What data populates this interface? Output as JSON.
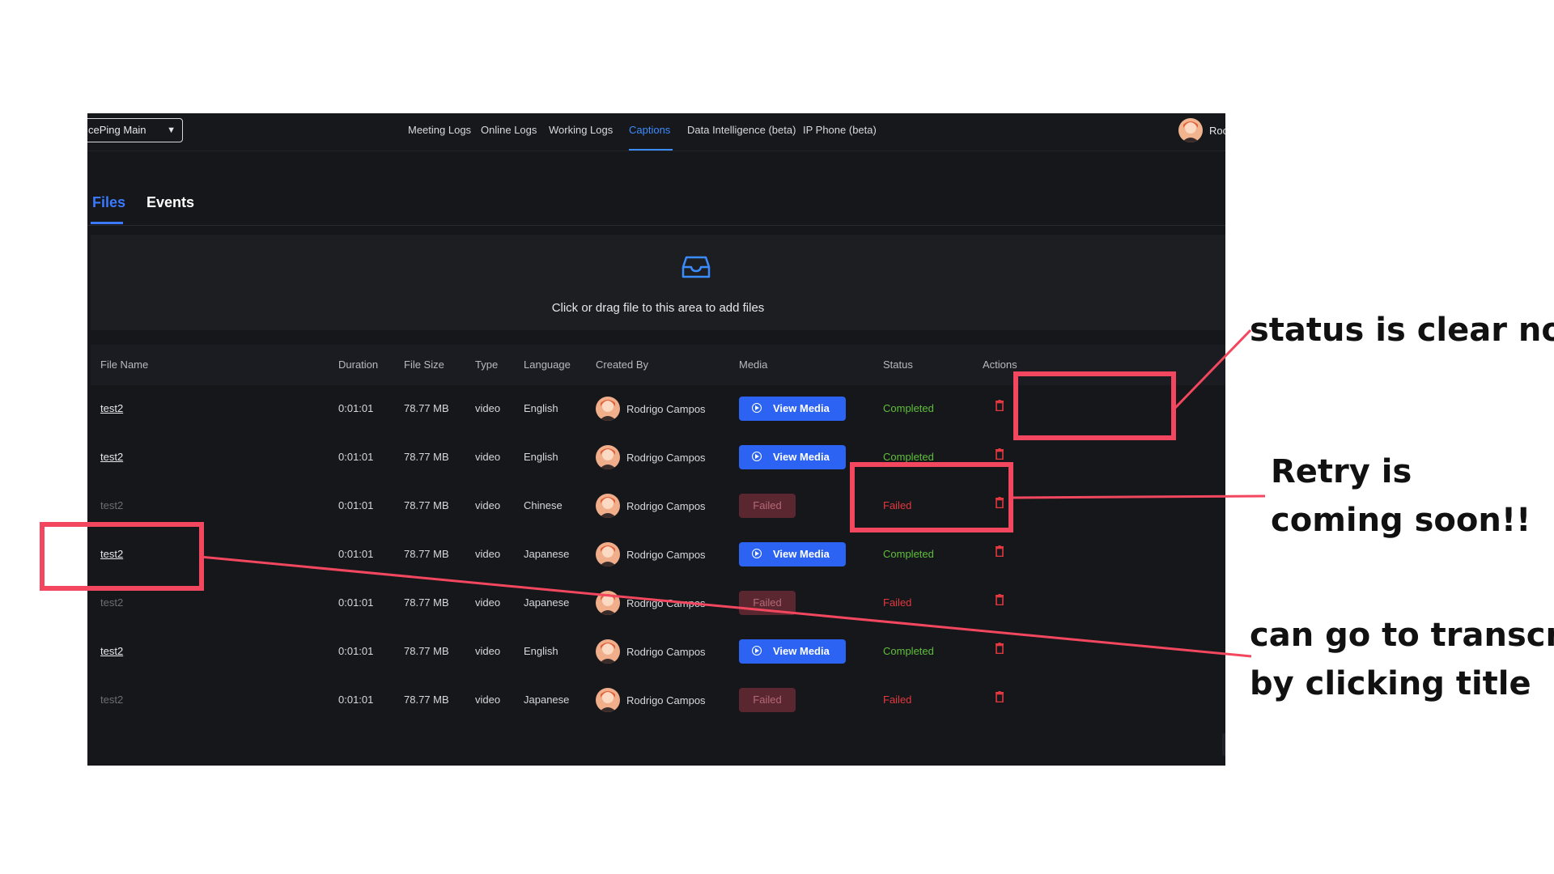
{
  "header": {
    "workspace": "cePing Main",
    "nav": [
      {
        "label": "Meeting Logs",
        "active": false
      },
      {
        "label": "Online Logs",
        "active": false
      },
      {
        "label": "Working Logs",
        "active": false
      },
      {
        "label": "Captions",
        "active": true
      },
      {
        "label": "Data Intelligence (beta)",
        "active": false
      },
      {
        "label": "IP Phone (beta)",
        "active": false
      }
    ],
    "user_name": "Roc"
  },
  "tabs": [
    {
      "label": "Files",
      "active": true
    },
    {
      "label": "Events",
      "active": false
    }
  ],
  "dropzone": {
    "icon": "inbox-icon",
    "text": "Click or drag file to this area to add files"
  },
  "table": {
    "columns": [
      "File Name",
      "Duration",
      "File Size",
      "Type",
      "Language",
      "Created By",
      "Media",
      "Status",
      "Actions"
    ],
    "rows": [
      {
        "file_name": "test2",
        "clickable": true,
        "duration": "0:01:01",
        "file_size": "78.77 MB",
        "type": "video",
        "language": "English",
        "created_by": "Rodrigo Campos",
        "media": "View Media",
        "status": "Completed"
      },
      {
        "file_name": "test2",
        "clickable": true,
        "duration": "0:01:01",
        "file_size": "78.77 MB",
        "type": "video",
        "language": "English",
        "created_by": "Rodrigo Campos",
        "media": "View Media",
        "status": "Completed"
      },
      {
        "file_name": "test2",
        "clickable": false,
        "duration": "0:01:01",
        "file_size": "78.77 MB",
        "type": "video",
        "language": "Chinese",
        "created_by": "Rodrigo Campos",
        "media": "Failed",
        "status": "Failed"
      },
      {
        "file_name": "test2",
        "clickable": true,
        "duration": "0:01:01",
        "file_size": "78.77 MB",
        "type": "video",
        "language": "Japanese",
        "created_by": "Rodrigo Campos",
        "media": "View Media",
        "status": "Completed"
      },
      {
        "file_name": "test2",
        "clickable": false,
        "duration": "0:01:01",
        "file_size": "78.77 MB",
        "type": "video",
        "language": "Japanese",
        "created_by": "Rodrigo Campos",
        "media": "Failed",
        "status": "Failed"
      },
      {
        "file_name": "test2",
        "clickable": true,
        "duration": "0:01:01",
        "file_size": "78.77 MB",
        "type": "video",
        "language": "English",
        "created_by": "Rodrigo Campos",
        "media": "View Media",
        "status": "Completed"
      },
      {
        "file_name": "test2",
        "clickable": false,
        "duration": "0:01:01",
        "file_size": "78.77 MB",
        "type": "video",
        "language": "Japanese",
        "created_by": "Rodrigo Campos",
        "media": "Failed",
        "status": "Failed"
      }
    ]
  },
  "pager": {
    "prev_icon": "chevron-left-icon"
  },
  "annotations": {
    "status_note": "status is clear now",
    "retry_note_line1": "Retry is",
    "retry_note_line2": "coming soon!!",
    "title_note_line1": "can go to transcript",
    "title_note_line2": "by clicking title"
  },
  "colors": {
    "accent": "#3b8cff",
    "completed": "#5fbf3a",
    "failed": "#e2383f",
    "annotation": "#f2475e"
  }
}
